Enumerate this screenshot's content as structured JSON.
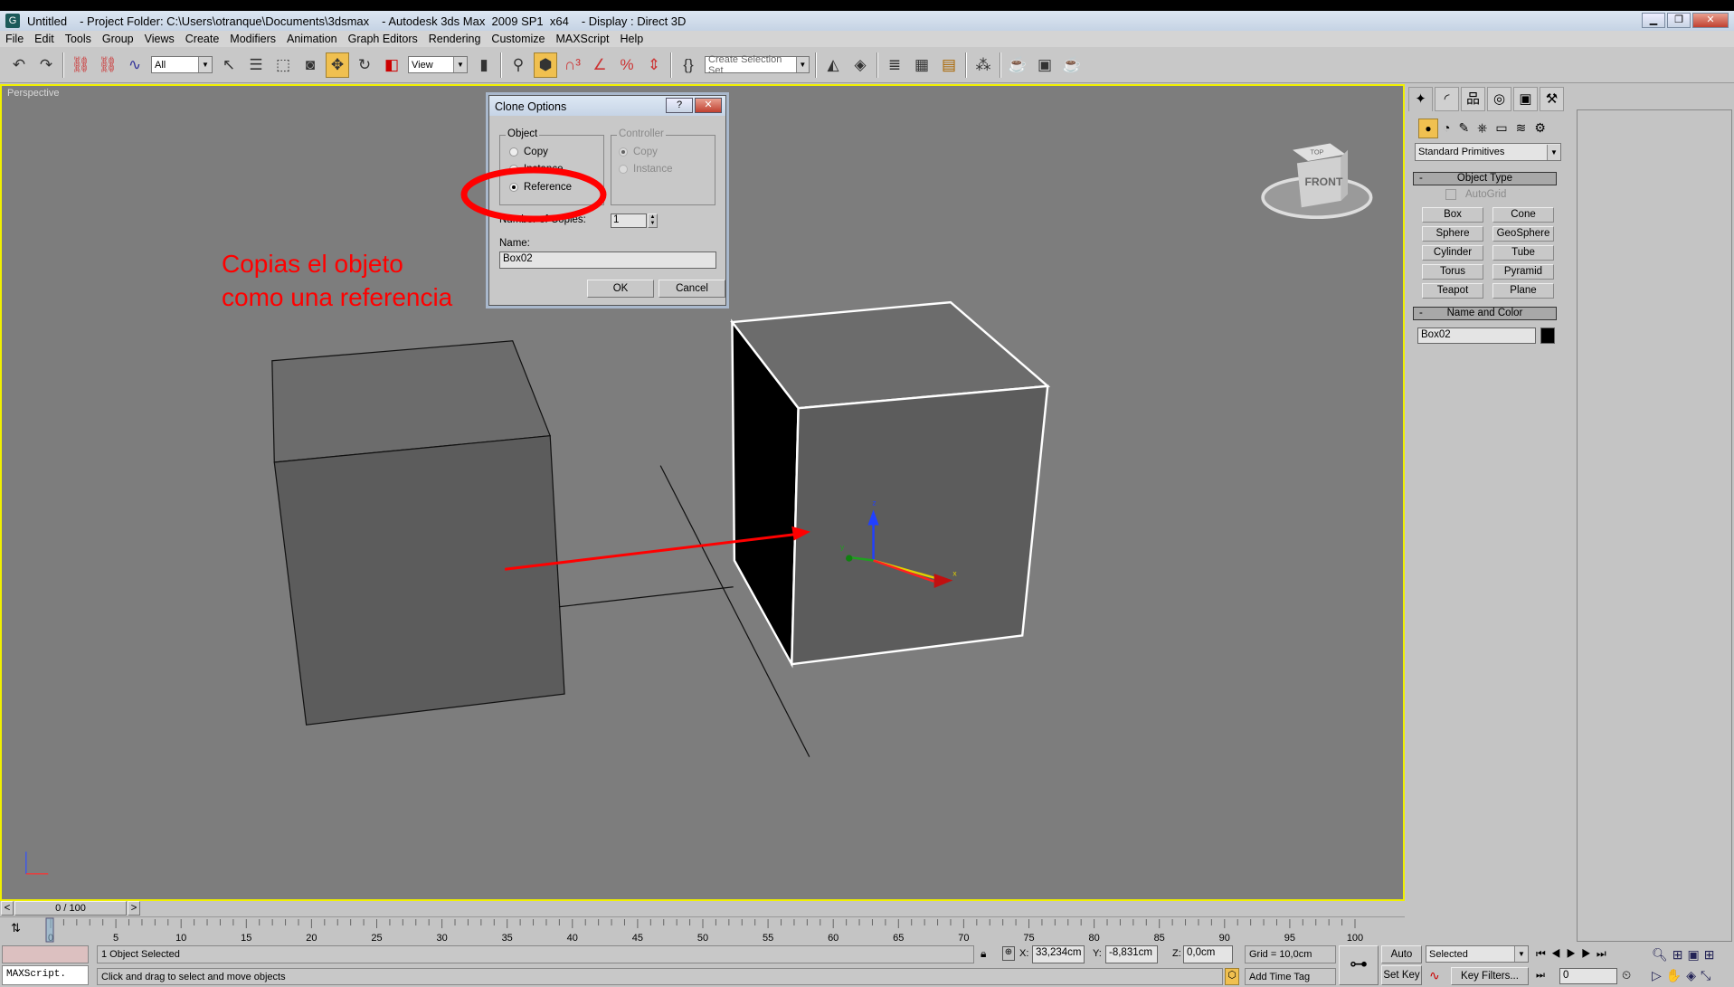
{
  "window": {
    "title_parts": [
      "Untitled",
      "- Project Folder: C:\\Users\\otranque\\Documents\\3dsmax",
      "- Autodesk 3ds Max  2009 SP1  x64",
      "- Display : Direct 3D"
    ],
    "logo": "3ds-max-logo",
    "controls": [
      "minimize",
      "maximize",
      "close"
    ]
  },
  "menu": [
    "File",
    "Edit",
    "Tools",
    "Group",
    "Views",
    "Create",
    "Modifiers",
    "Animation",
    "Graph Editors",
    "Rendering",
    "Customize",
    "MAXScript",
    "Help"
  ],
  "toolbar": {
    "selection_filter": "All",
    "ref_coord": "View",
    "named_selection_placeholder": "Create Selection Set",
    "active_tool": "select-and-move",
    "accent": "#f0c050"
  },
  "viewport": {
    "label": "Perspective",
    "border_color": "#f0f000",
    "annotation": [
      "Copias el objeto",
      "como una referencia"
    ],
    "annotation_color": "#ff0000",
    "viewcube": {
      "top": "TOP",
      "front": "FRONT"
    },
    "gizmo_axes": [
      "x",
      "y",
      "z"
    ]
  },
  "dialog": {
    "title": "Clone Options",
    "help": "?",
    "close": "✕",
    "object_group": "Object",
    "object_options": [
      "Copy",
      "Instance",
      "Reference"
    ],
    "object_selected": "Reference",
    "controller_group": "Controller",
    "controller_options": [
      "Copy",
      "Instance"
    ],
    "controller_selected": "Copy",
    "copies_label": "Number of Copies:",
    "copies_value": "1",
    "name_label": "Name:",
    "name_value": "Box02",
    "ok": "OK",
    "cancel": "Cancel"
  },
  "command_panel": {
    "category": "Standard Primitives",
    "object_type_title": "Object Type",
    "collapse": "-",
    "autogrid": "AutoGrid",
    "buttons": [
      "Box",
      "Cone",
      "Sphere",
      "GeoSphere",
      "Cylinder",
      "Tube",
      "Torus",
      "Pyramid",
      "Teapot",
      "Plane"
    ],
    "name_color_title": "Name and Color",
    "object_name": "Box02",
    "object_color": "#000000"
  },
  "timeline": {
    "frame_display": "0 / 100",
    "prev": "<",
    "next": ">",
    "ticks": [
      "0",
      "5",
      "10",
      "15",
      "20",
      "25",
      "30",
      "35",
      "40",
      "45",
      "50",
      "55",
      "60",
      "65",
      "70",
      "75",
      "80",
      "85",
      "90",
      "95",
      "100"
    ],
    "current_frame": 0
  },
  "status": {
    "maxscript": "MAXScript.",
    "selected": "1 Object Selected",
    "prompt": "Click and drag to select and move objects",
    "x_label": "X:",
    "x": "33,234cm",
    "y_label": "Y:",
    "y": "-8,831cm",
    "z_label": "Z:",
    "z": "0,0cm",
    "grid": "Grid = 10,0cm",
    "add_time_tag": "Add Time Tag",
    "auto_key": "Auto Key",
    "set_key": "Set Key",
    "key_mode": "Selected",
    "key_filters": "Key Filters...",
    "frame": "0"
  }
}
